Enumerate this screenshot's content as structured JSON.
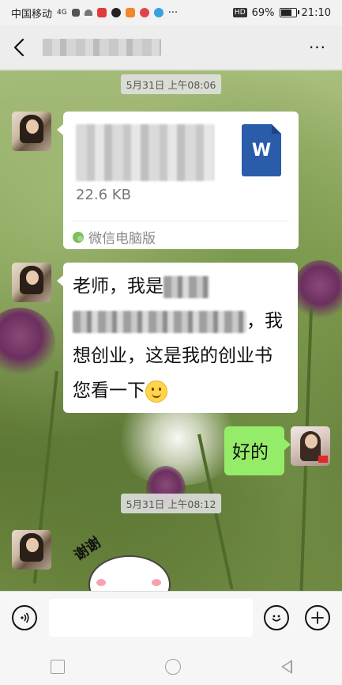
{
  "status_bar": {
    "carrier": "中国移动",
    "network_hint": "4G",
    "battery_percent": "69%",
    "time": "21:10",
    "hd_badge": "HD",
    "more_indicator": "···"
  },
  "nav": {
    "back_icon": "‹",
    "more_icon": "···"
  },
  "chat": {
    "time_1": "5月31日 上午08:06",
    "time_2": "5月31日 上午08:12",
    "file_message": {
      "size": "22.6 KB",
      "source": "微信电脑版",
      "icon_letter": "W"
    },
    "text_message": {
      "part_1": "老师，我是",
      "part_2": "，我想创业，这是我的创业书您看一下"
    },
    "reply": "好的",
    "sticker_text": "谢谢"
  },
  "input": {
    "placeholder": ""
  },
  "colors": {
    "my_bubble": "#95ec69",
    "word_icon": "#2a5caa",
    "bg_chrome": "#ededed"
  }
}
